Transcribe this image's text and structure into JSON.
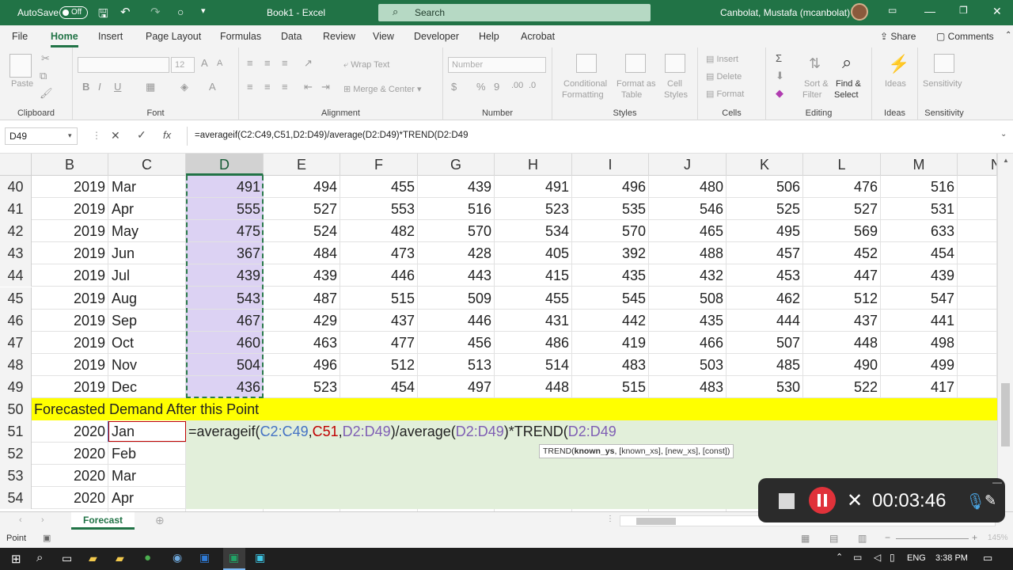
{
  "titlebar": {
    "autosave_label": "AutoSave",
    "autosave_state": "Off",
    "doc_title": "Book1 - Excel",
    "search_placeholder": "Search",
    "user": "Canbolat, Mustafa (mcanbolat)"
  },
  "tabs": [
    "File",
    "Home",
    "Insert",
    "Page Layout",
    "Formulas",
    "Data",
    "Review",
    "View",
    "Developer",
    "Help",
    "Acrobat"
  ],
  "active_tab": "Home",
  "share_label": "Share",
  "comments_label": "Comments",
  "ribbon": {
    "clipboard": {
      "label": "Clipboard",
      "paste": "Paste"
    },
    "font": {
      "label": "Font",
      "size": "12"
    },
    "alignment": {
      "label": "Alignment",
      "wrap": "Wrap Text",
      "merge": "Merge & Center"
    },
    "number": {
      "label": "Number",
      "format": "Number"
    },
    "styles": {
      "label": "Styles",
      "cond": "Conditional",
      "cond2": "Formatting",
      "fmt": "Format as",
      "fmt2": "Table",
      "cell": "Cell",
      "cell2": "Styles"
    },
    "cells": {
      "label": "Cells",
      "insert": "Insert",
      "delete": "Delete",
      "format": "Format"
    },
    "editing": {
      "label": "Editing",
      "sort": "Sort &",
      "sort2": "Filter",
      "find": "Find &",
      "find2": "Select"
    },
    "ideas": {
      "label": "Ideas",
      "btn": "Ideas"
    },
    "sensitivity": {
      "label": "Sensitivity",
      "btn": "Sensitivity"
    }
  },
  "formula_bar": {
    "name_box": "D49",
    "formula": "=averageif(C2:C49,C51,D2:D49)/average(D2:D49)*TREND(D2:D49"
  },
  "columns": [
    "B",
    "C",
    "D",
    "E",
    "F",
    "G",
    "H",
    "I",
    "J",
    "K",
    "L",
    "M",
    "N"
  ],
  "rows": [
    {
      "n": "40",
      "b": "2019",
      "c": "Mar",
      "vals": [
        "491",
        "494",
        "455",
        "439",
        "491",
        "496",
        "480",
        "506",
        "476",
        "516"
      ]
    },
    {
      "n": "41",
      "b": "2019",
      "c": "Apr",
      "vals": [
        "555",
        "527",
        "553",
        "516",
        "523",
        "535",
        "546",
        "525",
        "527",
        "531"
      ]
    },
    {
      "n": "42",
      "b": "2019",
      "c": "May",
      "vals": [
        "475",
        "524",
        "482",
        "570",
        "534",
        "570",
        "465",
        "495",
        "569",
        "633"
      ]
    },
    {
      "n": "43",
      "b": "2019",
      "c": "Jun",
      "vals": [
        "367",
        "484",
        "473",
        "428",
        "405",
        "392",
        "488",
        "457",
        "452",
        "454"
      ]
    },
    {
      "n": "44",
      "b": "2019",
      "c": "Jul",
      "vals": [
        "439",
        "439",
        "446",
        "443",
        "415",
        "435",
        "432",
        "453",
        "447",
        "439"
      ]
    },
    {
      "n": "45",
      "b": "2019",
      "c": "Aug",
      "vals": [
        "543",
        "487",
        "515",
        "509",
        "455",
        "545",
        "508",
        "462",
        "512",
        "547"
      ]
    },
    {
      "n": "46",
      "b": "2019",
      "c": "Sep",
      "vals": [
        "467",
        "429",
        "437",
        "446",
        "431",
        "442",
        "435",
        "444",
        "437",
        "441"
      ]
    },
    {
      "n": "47",
      "b": "2019",
      "c": "Oct",
      "vals": [
        "460",
        "463",
        "477",
        "456",
        "486",
        "419",
        "466",
        "507",
        "448",
        "498"
      ]
    },
    {
      "n": "48",
      "b": "2019",
      "c": "Nov",
      "vals": [
        "504",
        "496",
        "512",
        "513",
        "514",
        "483",
        "503",
        "485",
        "490",
        "499"
      ]
    },
    {
      "n": "49",
      "b": "2019",
      "c": "Dec",
      "vals": [
        "436",
        "523",
        "454",
        "497",
        "448",
        "515",
        "483",
        "530",
        "522",
        "417"
      ]
    }
  ],
  "banner_row": {
    "n": "50",
    "text": "Forecasted Demand After this Point"
  },
  "forecast_rows": [
    {
      "n": "51",
      "b": "2020",
      "c": "Jan"
    },
    {
      "n": "52",
      "b": "2020",
      "c": "Feb"
    },
    {
      "n": "53",
      "b": "2020",
      "c": "Mar"
    },
    {
      "n": "54",
      "b": "2020",
      "c": "Apr"
    }
  ],
  "edit_formula": {
    "p1": "=averageif(",
    "r1": "C2:C49",
    "c1": ",",
    "r2": "C51",
    "c2": ",",
    "r3": "D2:D49",
    "p2": ")/average(",
    "r4": "D2:D49",
    "p3": ")*TREND(",
    "r5": "D2:D49"
  },
  "tooltip": {
    "fn": "TREND(",
    "arg1": "known_ys",
    "rest": ", [known_xs], [new_xs], [const])"
  },
  "sheet_tab": "Forecast",
  "status_mode": "Point",
  "zoom": "145%",
  "recorder_time": "00:03:46",
  "clock": "3:38 PM",
  "lang": "ENG",
  "colors": {
    "excel_green": "#217346",
    "banner_yellow": "#ffff00",
    "forecast_green": "#e2efda",
    "selection_purple": "#dcd2f3",
    "ref_blue": "#4472c4",
    "ref_red": "#c00000",
    "ref_purple": "#7f5fb4"
  }
}
